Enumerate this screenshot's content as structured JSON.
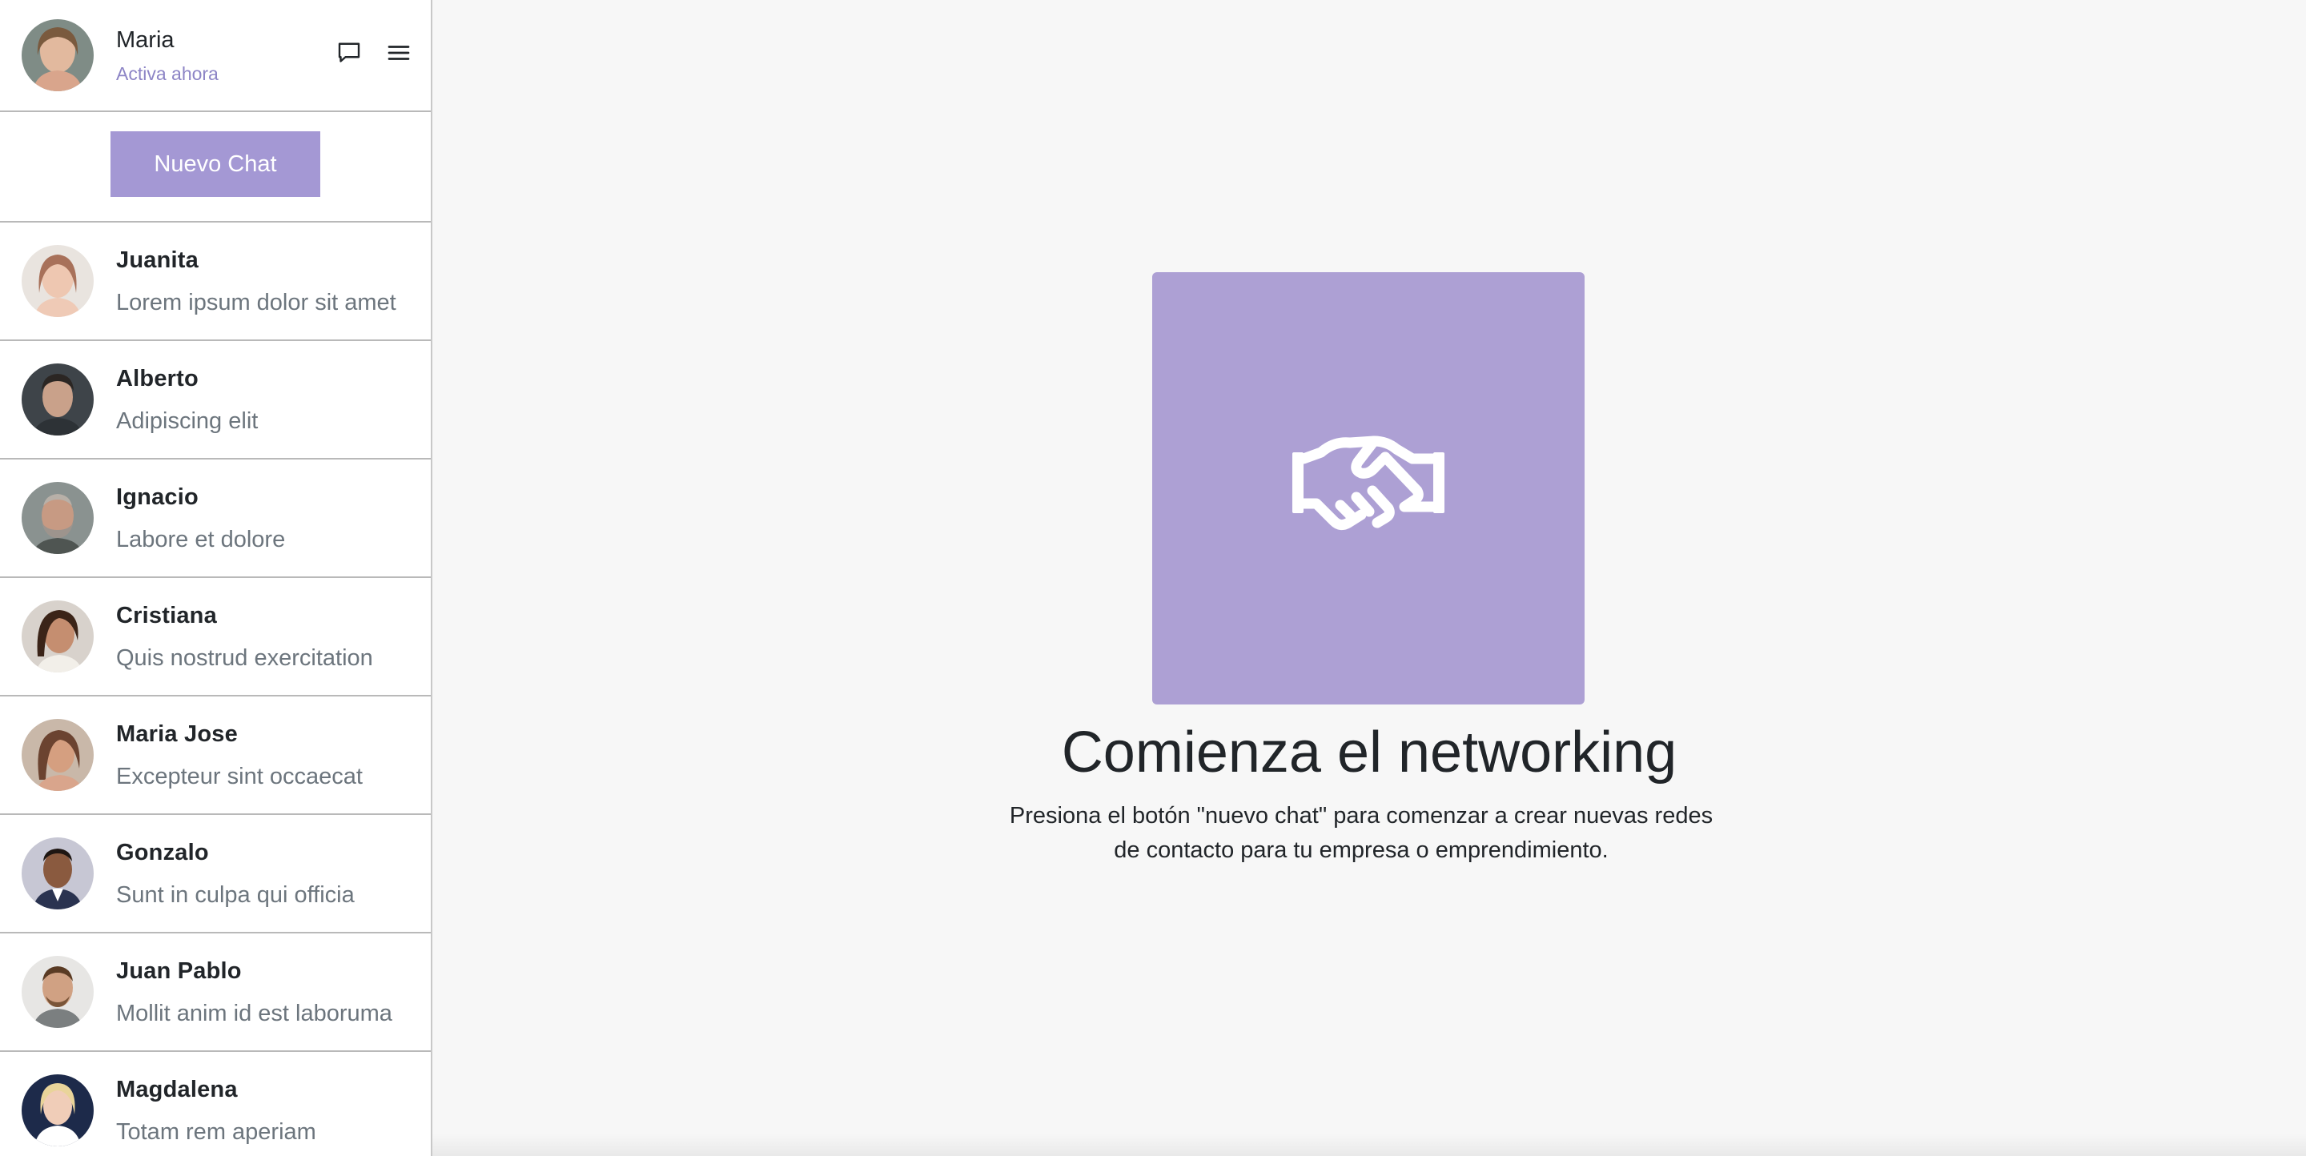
{
  "current_user": {
    "name": "Maria",
    "status": "Activa ahora",
    "avatar": "woman-portrait-avatar"
  },
  "header_icons": [
    "message-square-icon",
    "hamburger-menu-icon"
  ],
  "new_chat_label": "Nuevo Chat",
  "chats": [
    {
      "name": "Juanita",
      "preview": "Lorem ipsum dolor sit amet"
    },
    {
      "name": "Alberto",
      "preview": "Adipiscing elit"
    },
    {
      "name": "Ignacio",
      "preview": "Labore et dolore"
    },
    {
      "name": "Cristiana",
      "preview": "Quis nostrud exercitation"
    },
    {
      "name": "Maria Jose",
      "preview": "Excepteur sint occaecat"
    },
    {
      "name": "Gonzalo",
      "preview": "Sunt in culpa qui officia"
    },
    {
      "name": "Juan Pablo",
      "preview": "Mollit anim id est laboruma"
    },
    {
      "name": "Magdalena",
      "preview": "Totam rem aperiam"
    }
  ],
  "empty_state": {
    "icon": "handshake-icon",
    "title": "Comienza el networking",
    "description_line1": "Presiona el botón \"nuevo chat\" para comenzar a crear nuevas redes",
    "description_line2": "de contacto para tu empresa o emprendimiento."
  },
  "colors": {
    "accent": "#a498d4",
    "hero_bg": "#ada0d4",
    "status_text": "#8d85c6",
    "muted_text": "#6c757d"
  }
}
